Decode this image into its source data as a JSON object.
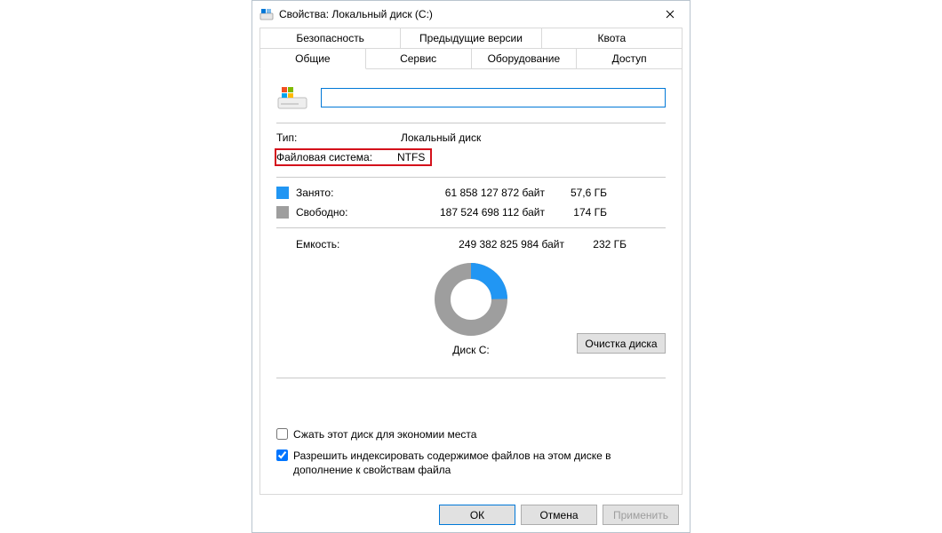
{
  "window": {
    "title": "Свойства: Локальный диск (C:)"
  },
  "tabs": {
    "row1": [
      "Безопасность",
      "Предыдущие версии",
      "Квота"
    ],
    "row2": [
      "Общие",
      "Сервис",
      "Оборудование",
      "Доступ"
    ],
    "active": "Общие"
  },
  "name_input": {
    "value": ""
  },
  "type": {
    "label": "Тип:",
    "value": "Локальный диск"
  },
  "filesystem": {
    "label": "Файловая система:",
    "value": "NTFS"
  },
  "used": {
    "label": "Занято:",
    "bytes": "61 858 127 872 байт",
    "gb": "57,6 ГБ"
  },
  "free": {
    "label": "Свободно:",
    "bytes": "187 524 698 112 байт",
    "gb": "174 ГБ"
  },
  "capacity": {
    "label": "Емкость:",
    "bytes": "249 382 825 984 байт",
    "gb": "232 ГБ"
  },
  "disk_label": "Диск C:",
  "cleanup": "Очистка диска",
  "compress": {
    "checked": false,
    "label": "Сжать этот диск для экономии места"
  },
  "index": {
    "checked": true,
    "label": "Разрешить индексировать содержимое файлов на этом диске в дополнение к свойствам файла"
  },
  "buttons": {
    "ok": "ОК",
    "cancel": "Отмена",
    "apply": "Применить"
  },
  "colors": {
    "used": "#2196f3",
    "free": "#9e9e9e",
    "accent": "#0078d7",
    "highlight": "#d4111b"
  },
  "chart_data": {
    "type": "pie",
    "title": "Диск C:",
    "series": [
      {
        "name": "Занято",
        "value": 61858127872,
        "color": "#2196f3"
      },
      {
        "name": "Свободно",
        "value": 187524698112,
        "color": "#9e9e9e"
      }
    ]
  }
}
